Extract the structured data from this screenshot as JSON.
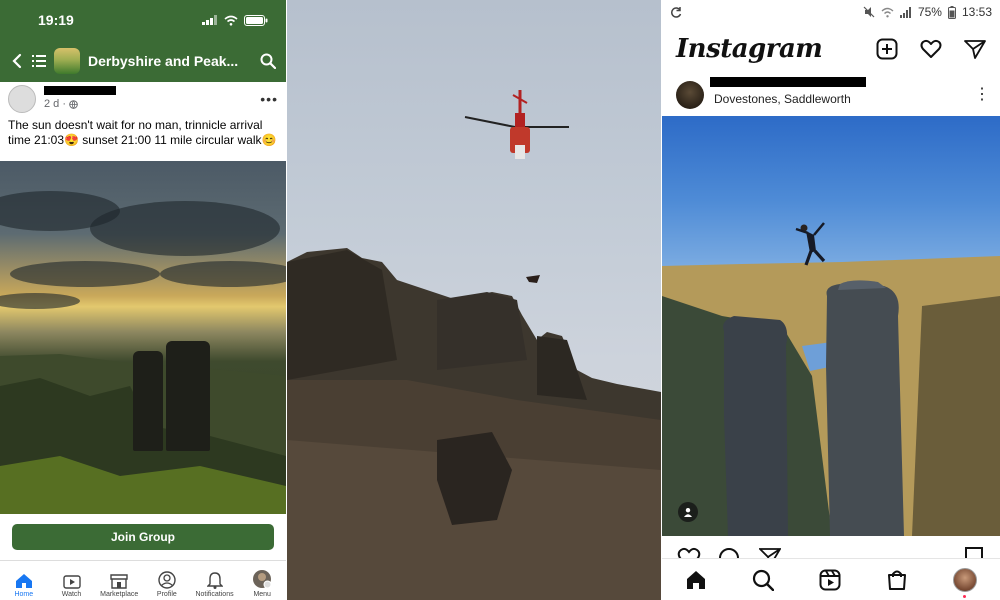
{
  "facebook": {
    "status": {
      "time": "19:19"
    },
    "header": {
      "group_name": "Derbyshire and Peak..."
    },
    "post": {
      "time_ago": "2 d ·",
      "text": "The sun doesn't wait for no man, trinnicle arrival time 21:03😍 sunset 21:00 11 mile circular walk😊"
    },
    "join_label": "Join Group",
    "tabs": [
      {
        "label": "Home",
        "icon": "home-icon"
      },
      {
        "label": "Watch",
        "icon": "video-icon"
      },
      {
        "label": "Marketplace",
        "icon": "shop-icon"
      },
      {
        "label": "Profile",
        "icon": "profile-icon"
      },
      {
        "label": "Notifications",
        "icon": "bell-icon"
      },
      {
        "label": "Menu",
        "icon": "menu-avatar-icon"
      }
    ],
    "colors": {
      "brand": "#3b6b35",
      "active": "#1877f2"
    }
  },
  "instagram": {
    "status": {
      "battery": "75%",
      "time": "13:53"
    },
    "logo": "Instagram",
    "post": {
      "location": "Dovestones, Saddleworth"
    },
    "nav": [
      "home-icon",
      "search-icon",
      "reels-icon",
      "shop-icon",
      "profile-icon"
    ]
  }
}
